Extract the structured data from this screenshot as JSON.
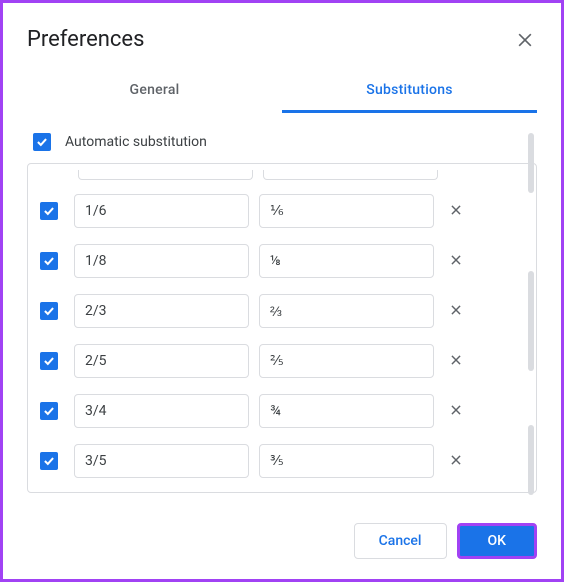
{
  "dialog": {
    "title": "Preferences"
  },
  "tabs": {
    "general": "General",
    "substitutions": "Substitutions"
  },
  "autoSub": {
    "label": "Automatic substitution",
    "checked": true
  },
  "substitutions": [
    {
      "checked": true,
      "replace": "1/6",
      "with": "⅙"
    },
    {
      "checked": true,
      "replace": "1/8",
      "with": "⅛"
    },
    {
      "checked": true,
      "replace": "2/3",
      "with": "⅔"
    },
    {
      "checked": true,
      "replace": "2/5",
      "with": "⅖"
    },
    {
      "checked": true,
      "replace": "3/4",
      "with": "¾"
    },
    {
      "checked": true,
      "replace": "3/5",
      "with": "⅗"
    }
  ],
  "footer": {
    "cancel": "Cancel",
    "ok": "OK"
  }
}
